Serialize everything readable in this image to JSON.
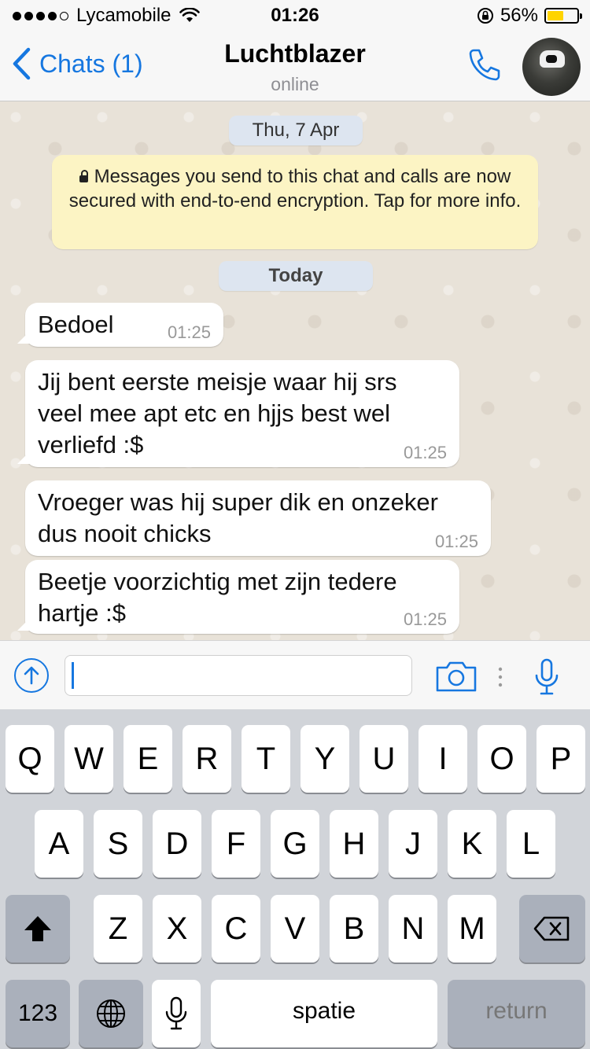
{
  "status_bar": {
    "carrier": "Lycamobile",
    "time": "01:26",
    "battery": "56%",
    "battery_level": 0.56,
    "icons": [
      "signal-dots",
      "wifi-icon",
      "rotation-lock-icon",
      "battery-icon"
    ]
  },
  "nav": {
    "back_label": "Chats (1)",
    "title": "Luchtblazer",
    "subtitle": "online",
    "icons": [
      "chevron-left-icon",
      "phone-icon",
      "contact-avatar"
    ]
  },
  "chat": {
    "date_pill": "Thu, 7 Apr",
    "encryption_notice": "Messages you send to this chat and calls are now secured with end-to-end encryption. Tap for more info.",
    "today_pill": "Today",
    "messages": [
      {
        "text": "Bedoel",
        "time": "01:25"
      },
      {
        "text": "Jij bent eerste meisje waar hij srs veel mee apt etc en hjjs best wel verliefd :$",
        "time": "01:25"
      },
      {
        "text": "Vroeger was hij super dik en onzeker dus nooit chicks",
        "time": "01:25"
      },
      {
        "text": "Beetje voorzichtig met zijn tedere hartje :$",
        "time": "01:25"
      }
    ]
  },
  "input_bar": {
    "text_value": "",
    "icons": [
      "upload-arrow-icon",
      "camera-icon",
      "more-dots-icon",
      "microphone-icon"
    ]
  },
  "keyboard": {
    "row1": [
      "Q",
      "W",
      "E",
      "R",
      "T",
      "Y",
      "U",
      "I",
      "O",
      "P"
    ],
    "row2": [
      "A",
      "S",
      "D",
      "F",
      "G",
      "H",
      "J",
      "K",
      "L"
    ],
    "row3": [
      "Z",
      "X",
      "C",
      "V",
      "B",
      "N",
      "M"
    ],
    "num_label": "123",
    "space_label": "spatie",
    "return_label": "return",
    "icons": [
      "shift-icon",
      "backspace-icon",
      "globe-icon",
      "dictation-mic-icon"
    ]
  },
  "colors": {
    "accent": "#1677e0",
    "notice_bg": "#fcf4c4",
    "pill_bg": "#dde5f0",
    "battery": "#ffd400"
  }
}
